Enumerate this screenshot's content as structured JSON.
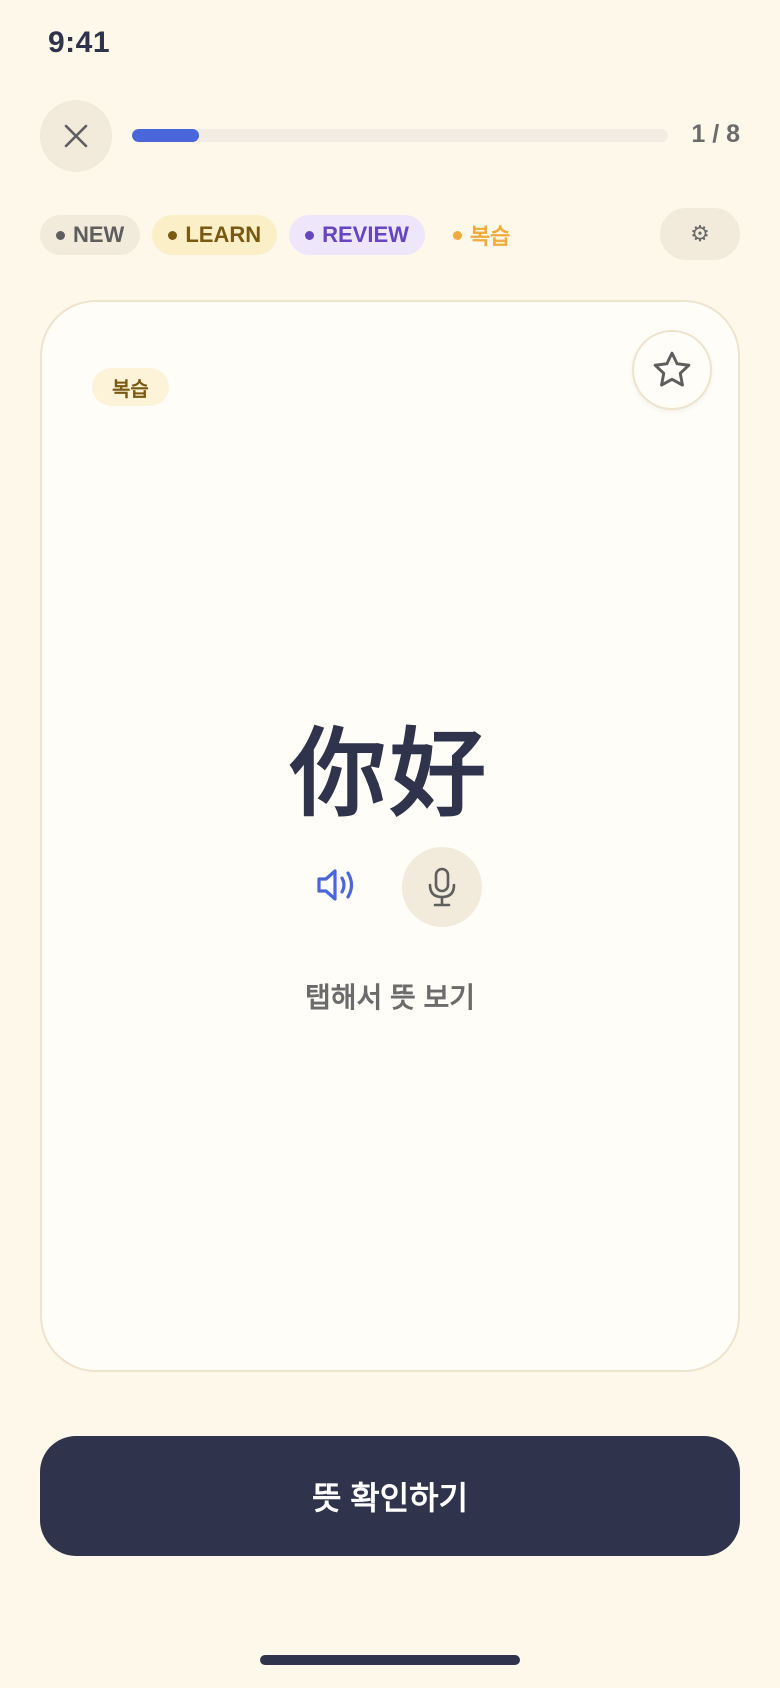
{
  "status_bar": {
    "time": "9:41"
  },
  "header": {
    "close_icon": "close-icon",
    "progress": {
      "current": 1,
      "total": 8,
      "fraction": 0.125,
      "label": "1 / 8"
    }
  },
  "filters": {
    "chips": [
      {
        "label": "NEW",
        "color": "#5E5E5E"
      },
      {
        "label": "LEARN",
        "color": "#7A5A12"
      },
      {
        "label": "REVIEW",
        "color": "#6744C0"
      },
      {
        "label": "복습",
        "color": "#F2AA3A"
      }
    ],
    "settings_icon": "⚙"
  },
  "card": {
    "badge": "복습",
    "star_icon": "star-icon",
    "word": "你好",
    "speaker_icon": "speaker-icon",
    "mic_icon": "microphone-icon",
    "hint": "탭해서 뜻 보기"
  },
  "actions": {
    "confirm_label": "뜻 확인하기"
  },
  "colors": {
    "background": "#FEF8EA",
    "accent": "#4A66DB",
    "primary_dark": "#2F344C"
  }
}
